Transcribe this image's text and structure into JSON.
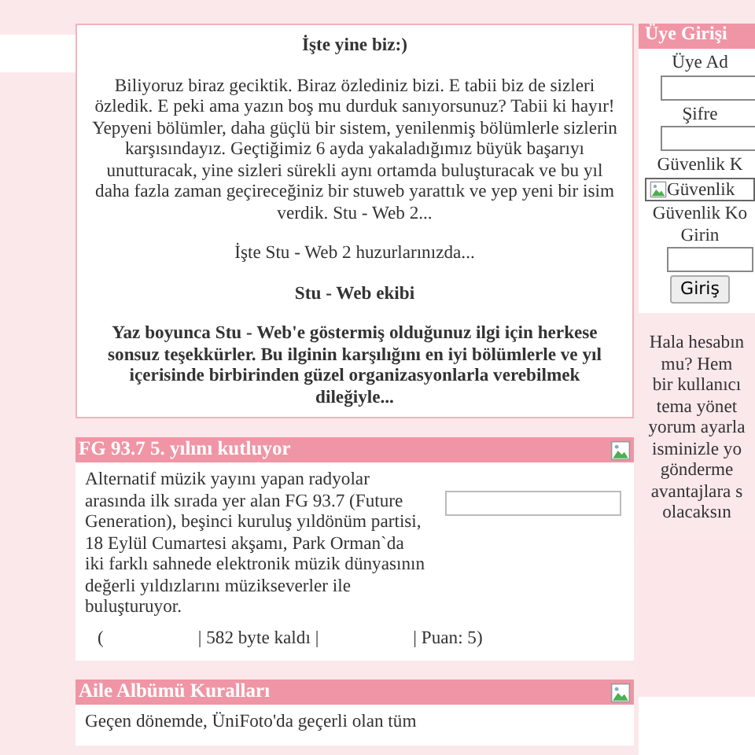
{
  "intro": {
    "paragraphs": [
      {
        "text": "İşte yine biz:)",
        "bold": true
      },
      {
        "text": "Biliyoruz biraz geciktik. Biraz özlediniz bizi. E tabii biz de sizleri özledik. E peki ama yazın boş mu durduk sanıyorsunuz? Tabii ki hayır! Yepyeni bölümler, daha güçlü bir sistem, yenilenmiş bölümlerle sizlerin karşısındayız. Geçtiğimiz 6 ayda yakaladığımız büyük başarıyı unutturacak, yine sizleri sürekli aynı ortamda buluşturacak ve bu yıl daha fazla zaman geçireceğiniz bir stuweb yarattık ve yep yeni bir isim verdik. Stu - Web 2...",
        "bold": false
      },
      {
        "text": "İşte Stu - Web 2 huzurlarınızda...",
        "bold": false
      },
      {
        "text": "Stu - Web ekibi",
        "bold": true
      },
      {
        "text": "Yaz boyunca Stu - Web'e göstermiş olduğunuz ilgi için herkese sonsuz teşekkürler. Bu ilginin karşılığını en iyi bölümlerle ve yıl içerisinde birbirinden güzel organizasyonlarla verebilmek dileğiyle...",
        "bold": true
      }
    ]
  },
  "news": [
    {
      "title": "FG 93.7 5. yılını kutluyor",
      "body": "Alternatif müzik yayını yapan radyolar arasında ilk sırada yer alan FG 93.7 (Future Generation), beşinci kuruluş yıldönüm partisi, 18 Eylül Cumartesi akşamı, Park Orman`da iki farklı sahnede elektronik müzik dünyasının değerli yıldızlarını müzikseverler ile buluşturuyor.",
      "footer": [
        "(",
        "| 582 byte kaldı |",
        "| Puan: 5)"
      ]
    },
    {
      "title": "Aile Albümü Kuralları",
      "body": "Geçen dönemde, ÜniFoto'da geçerli olan tüm"
    }
  ],
  "login": {
    "title": "Üye Girişi",
    "username_label": "Üye Ad",
    "password_label": "Şifre",
    "security_label": "Güvenlik K",
    "captcha_alt": "Güvenlik",
    "code_label": [
      "Güvenlik Ko",
      "Girin"
    ],
    "button": "Giriş"
  },
  "signup_lines": [
    "Hala hesabın",
    "mu? Hem",
    "bir kullanıcı",
    "tema yönet",
    "yorum ayarla",
    "isminizle yo",
    "gönderme",
    "avantajlara s",
    "olacaksın"
  ]
}
